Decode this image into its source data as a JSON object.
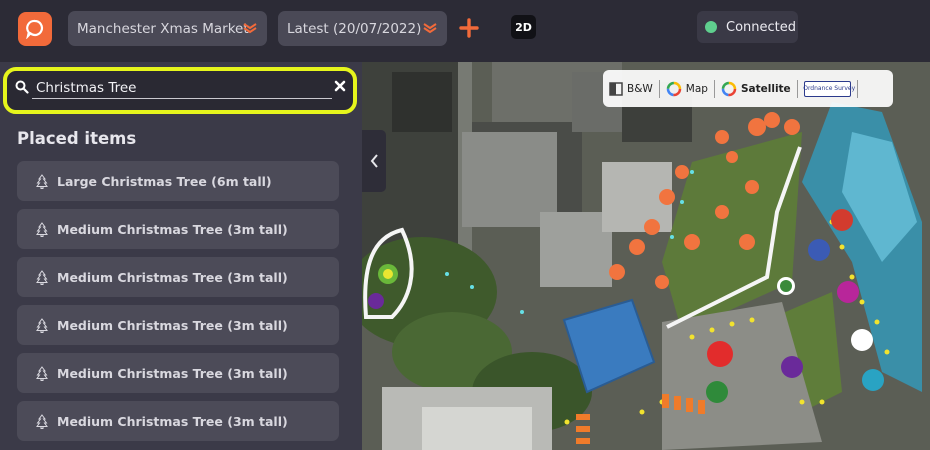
{
  "header": {
    "project_select": {
      "value": "Manchester Xmas Market"
    },
    "version_select": {
      "value": "Latest (20/07/2022)"
    },
    "view_toggle_label": "2D",
    "status": {
      "label": "Connected",
      "color": "#5fcf8e"
    }
  },
  "colors": {
    "accent": "#f26a3a",
    "search_highlight": "#e6f51c"
  },
  "search": {
    "value": "Christmas Tree",
    "placeholder": ""
  },
  "sidebar": {
    "section_title": "Placed items",
    "items": [
      {
        "label": "Large Christmas Tree (6m tall)"
      },
      {
        "label": "Medium Christmas Tree (3m tall)"
      },
      {
        "label": "Medium Christmas Tree (3m tall)"
      },
      {
        "label": "Medium Christmas Tree (3m tall)"
      },
      {
        "label": "Medium Christmas Tree (3m tall)"
      },
      {
        "label": "Medium Christmas Tree (3m tall)"
      }
    ]
  },
  "map_toolbar": {
    "bw_label": "B&W",
    "map_label": "Map",
    "satellite_label": "Satellite",
    "os_label": "Ordnance Survey"
  },
  "icons": [
    "logo-icon",
    "chevron-down-icon",
    "plus-icon",
    "search-icon",
    "close-icon",
    "tree-icon",
    "chevron-left-icon",
    "bw-icon",
    "google-icon",
    "ordnance-survey-icon"
  ]
}
